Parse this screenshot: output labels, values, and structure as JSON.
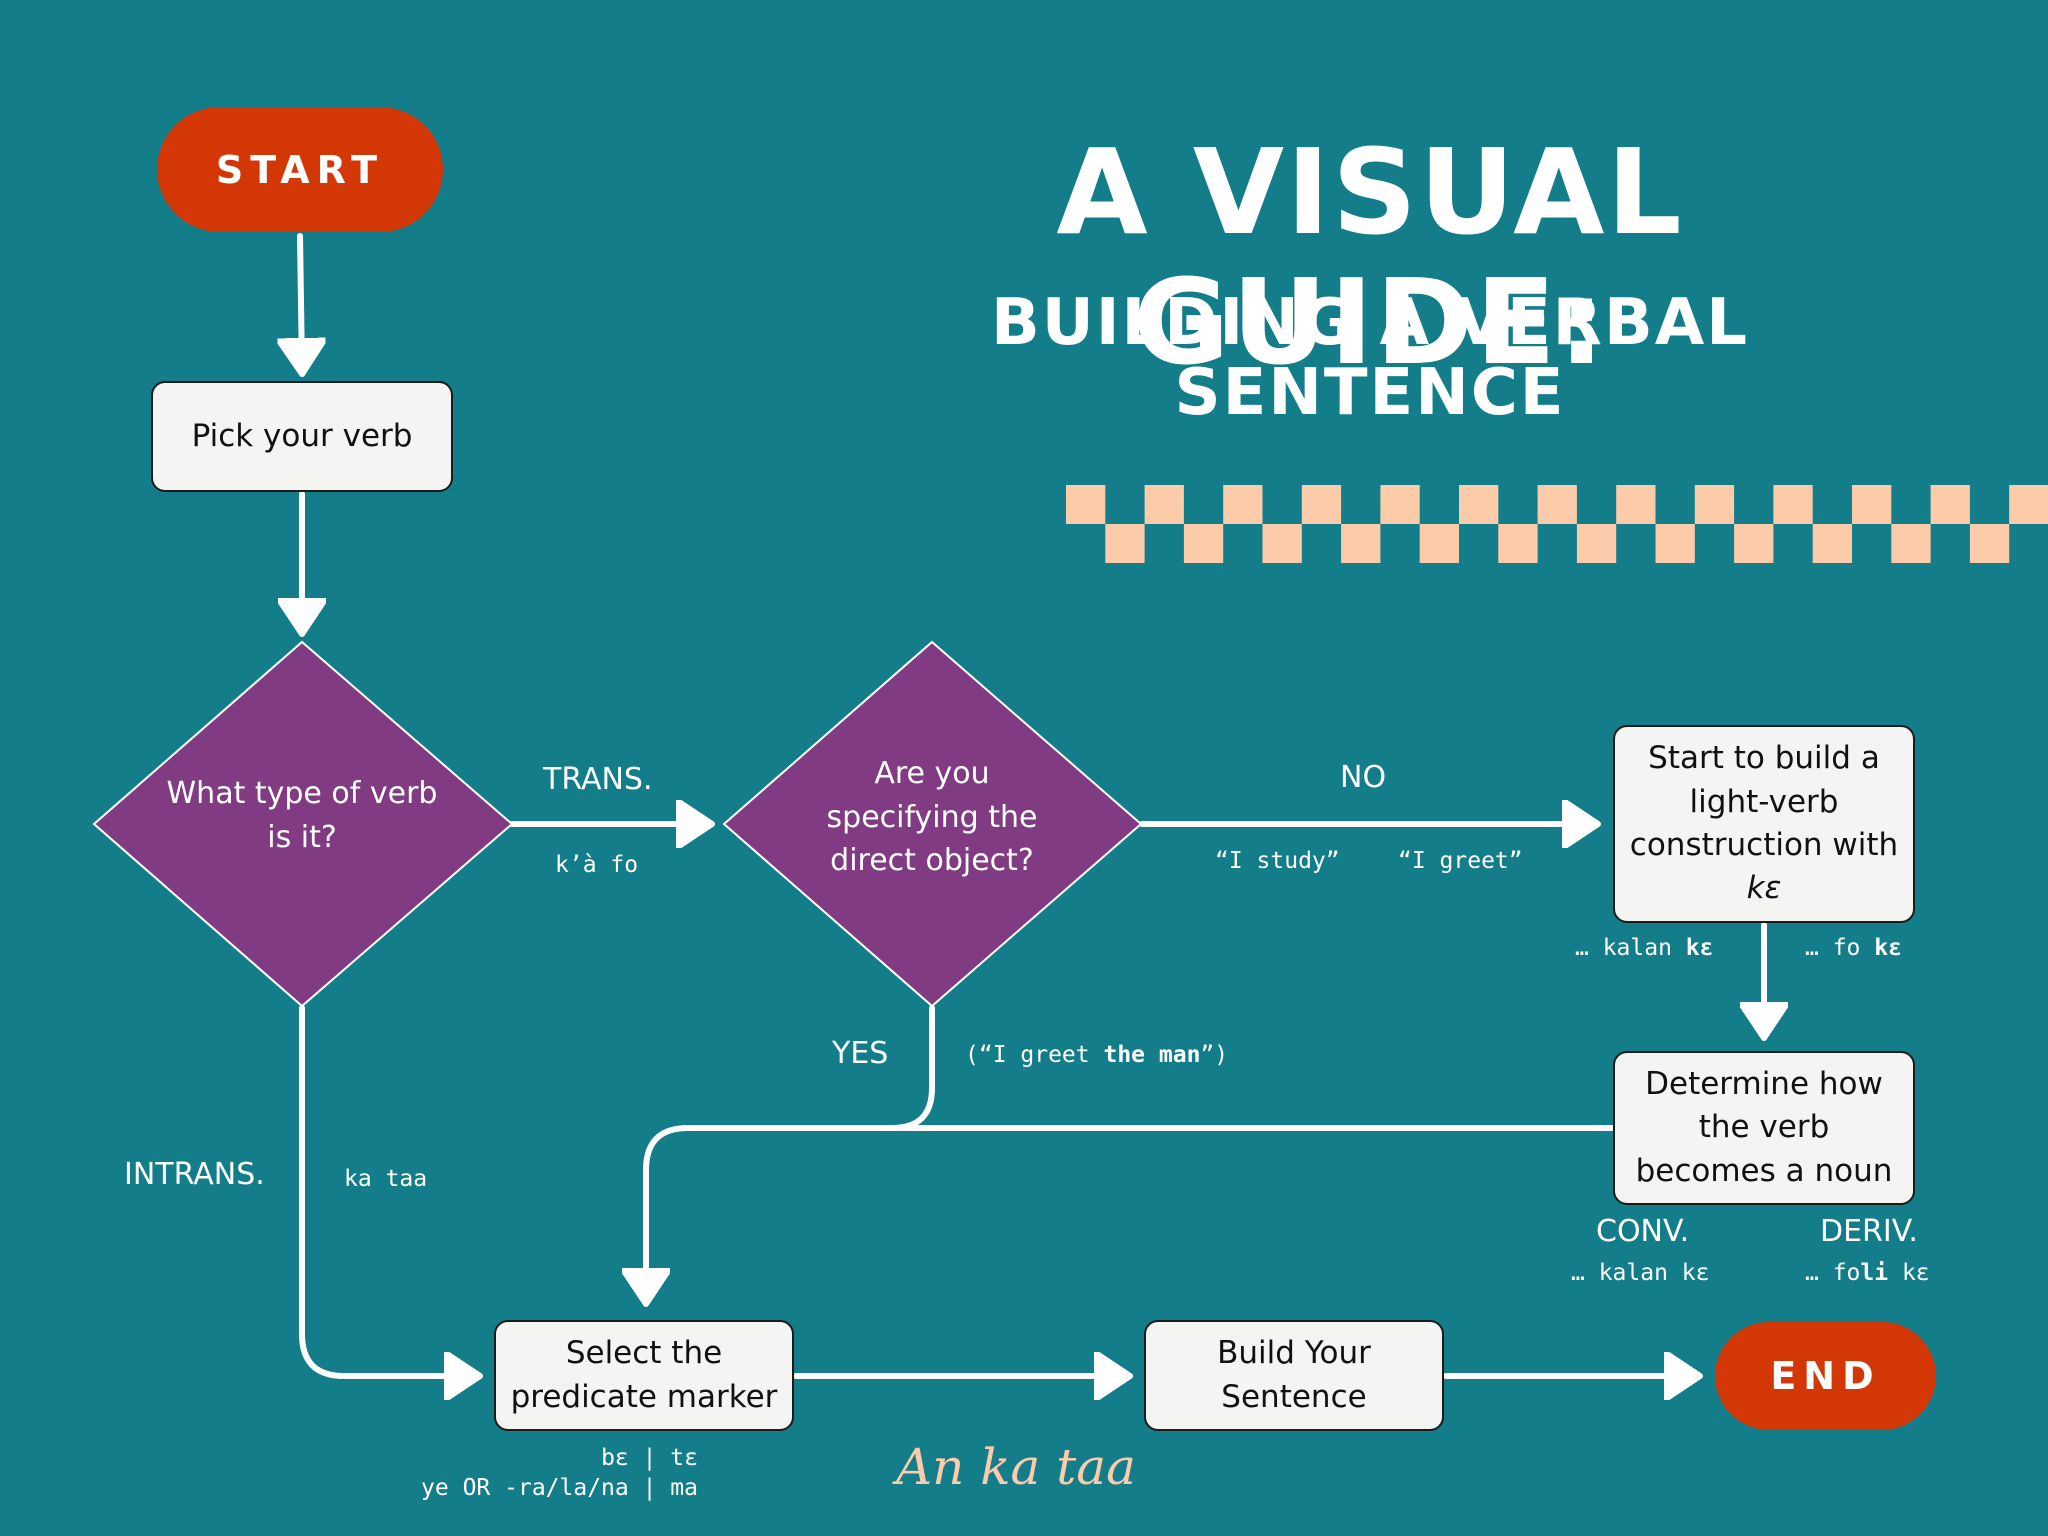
{
  "title": {
    "main": "A VISUAL GUIDE:",
    "sub": "BUILDING A VERBAL SENTENCE"
  },
  "colors": {
    "background": "#147d8a",
    "terminal": "#d43706",
    "decision": "#803b82",
    "process": "#f4f4f2",
    "accent": "#fccbaa"
  },
  "nodes": {
    "start": "START",
    "pick_verb": "Pick your verb",
    "verb_type": "What type of verb is it?",
    "direct_object": "Are you specifying the direct object?",
    "light_verb_prefix": "Start to build a light-verb construction with",
    "light_verb_word": "kɛ",
    "determine_noun": "Determine how the verb becomes a noun",
    "predicate_marker": "Select the predicate marker",
    "build_sentence": "Build Your Sentence",
    "end": "END"
  },
  "edges": {
    "trans_label": "TRANS.",
    "trans_example": "k’à fo",
    "no_label": "NO",
    "no_example_1": "“I study”",
    "no_example_2": "“I greet”",
    "yes_label": "YES",
    "yes_example_pre": "(“I greet ",
    "yes_example_bold": "the man",
    "yes_example_post": "”)",
    "intrans_label": "INTRANS.",
    "intrans_example": "ka taa",
    "lv_example_1_pre": "… kalan ",
    "lv_example_1_bold": "kɛ",
    "lv_example_2_pre": "… fo ",
    "lv_example_2_bold": "kɛ",
    "conv_label": "CONV.",
    "conv_example": "… kalan kɛ",
    "deriv_label": "DERIV.",
    "deriv_example_pre": "… fo",
    "deriv_example_bold": "li",
    "deriv_example_post": " kɛ",
    "pm_line_1": "bɛ | tɛ",
    "pm_line_2": "ye OR -ra/la/na | ma"
  },
  "footer": {
    "brand": "An ka taa"
  }
}
